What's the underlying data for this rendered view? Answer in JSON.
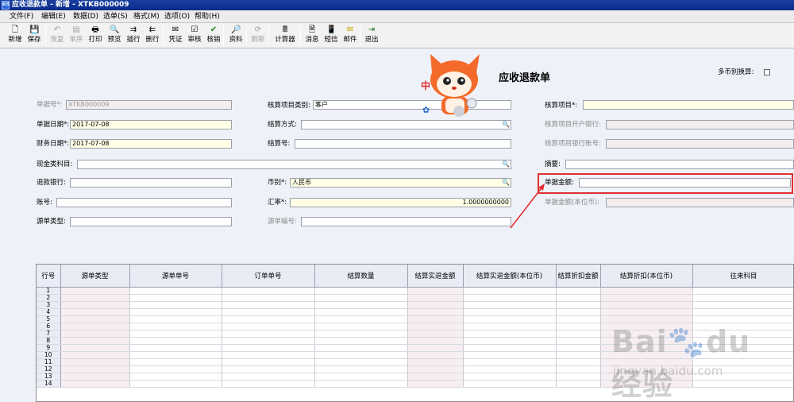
{
  "window": {
    "title": "应收退款单 - 新增 - XTKB000009",
    "app_icon": "KIS"
  },
  "menu": [
    "文件(F)",
    "编辑(E)",
    "数据(D)",
    "选单(S)",
    "格式(M)",
    "选项(O)",
    "帮助(H)"
  ],
  "toolbar": [
    {
      "label": "新增",
      "icon": "new-doc-icon",
      "enabled": true
    },
    {
      "label": "保存",
      "icon": "save-icon",
      "enabled": true
    },
    {
      "label": "恢复",
      "icon": "undo-icon",
      "enabled": false
    },
    {
      "label": "单序",
      "icon": "sort-icon",
      "enabled": false
    },
    {
      "label": "打印",
      "icon": "printer-icon",
      "enabled": true
    },
    {
      "label": "预览",
      "icon": "preview-icon",
      "enabled": true
    },
    {
      "label": "插行",
      "icon": "insert-row-icon",
      "enabled": true
    },
    {
      "label": "删行",
      "icon": "delete-row-icon",
      "enabled": true
    },
    {
      "label": "凭证",
      "icon": "voucher-icon",
      "enabled": true
    },
    {
      "label": "审核",
      "icon": "audit-icon",
      "enabled": true
    },
    {
      "label": "核销",
      "icon": "checkmark-icon",
      "enabled": true
    },
    {
      "label": "资料",
      "icon": "data-icon",
      "enabled": true
    },
    {
      "label": "刷新",
      "icon": "refresh-icon",
      "enabled": false
    },
    {
      "label": "计算器",
      "icon": "calculator-icon",
      "enabled": true
    },
    {
      "label": "消息",
      "icon": "message-icon",
      "enabled": true
    },
    {
      "label": "短信",
      "icon": "sms-icon",
      "enabled": true
    },
    {
      "label": "邮件",
      "icon": "mail-icon",
      "enabled": true
    },
    {
      "label": "退出",
      "icon": "exit-icon",
      "enabled": true
    }
  ],
  "form": {
    "title": "应收退款单",
    "multi_currency_label": "多币别换算:",
    "fields": {
      "bill_no": {
        "label": "单据号*:",
        "value": "XTKB000009"
      },
      "bill_date": {
        "label": "单据日期*:",
        "value": "2017-07-08"
      },
      "finance_date": {
        "label": "财务日期*:",
        "value": "2017-07-08"
      },
      "cash_account": {
        "label": "现金类科目:",
        "value": ""
      },
      "refund_bank": {
        "label": "退款银行:",
        "value": ""
      },
      "account_no": {
        "label": "账号:",
        "value": ""
      },
      "source_type": {
        "label": "源单类型:",
        "value": ""
      },
      "item_category": {
        "label": "核算项目类别:",
        "value": "客户"
      },
      "settle_method": {
        "label": "结算方式:",
        "value": ""
      },
      "settle_no": {
        "label": "结算号:",
        "value": ""
      },
      "currency": {
        "label": "币别*:",
        "value": "人民币"
      },
      "rate": {
        "label": "汇率*:",
        "value": "1.0000000000"
      },
      "source_no": {
        "label": "源单编号:",
        "value": ""
      },
      "item": {
        "label": "核算项目*:",
        "value": ""
      },
      "item_bank": {
        "label": "核算项目开户银行:",
        "value": ""
      },
      "item_bank_account": {
        "label": "核算项目银行账号:",
        "value": ""
      },
      "summary": {
        "label": "摘要:",
        "value": ""
      },
      "bill_amount": {
        "label": "单据金额:",
        "value": ""
      },
      "bill_amount_local": {
        "label": "单据金额(本位币):",
        "value": ""
      }
    }
  },
  "grid": {
    "columns": [
      "行号",
      "源单类型",
      "源单单号",
      "订单单号",
      "结算数量",
      "结算实退金额",
      "结算实退金额(本位币)",
      "结算折扣金额",
      "结算折扣(本位币)",
      "往来科目"
    ],
    "rows": [
      "1",
      "2",
      "3",
      "4",
      "5",
      "6",
      "7",
      "8",
      "9",
      "10",
      "11",
      "12",
      "13",
      "14"
    ]
  },
  "watermark": {
    "brand": "Bai",
    "brand2": "du",
    "brand_cn": "经验",
    "url": "jingyan.baidu.com"
  },
  "colors": {
    "highlight": "#e23030",
    "title_bar": "#0a2a8a",
    "required_field": "#ffffe6"
  }
}
